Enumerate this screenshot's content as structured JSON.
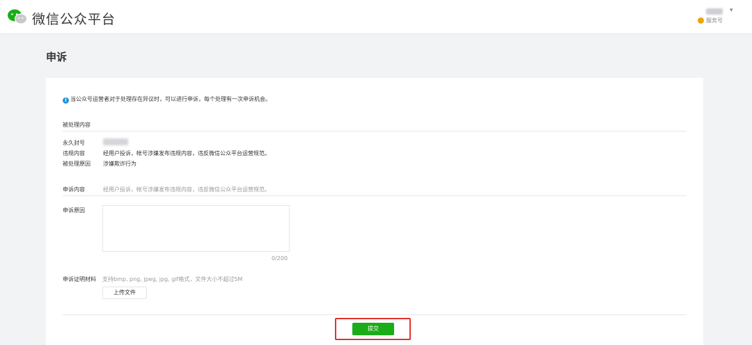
{
  "header": {
    "logo_text": "微信公众平台",
    "account_type": "服务号",
    "caret": "▾"
  },
  "page": {
    "title": "申诉"
  },
  "notice": {
    "icon": "info-icon",
    "icon_glyph": "i",
    "text": "当公众号运营者对于处理存在异议时，可以进行申诉，每个处理有一次申诉机会。"
  },
  "handled_section": {
    "title": "被处理内容",
    "rows": [
      {
        "label": "永久封号",
        "value": ""
      },
      {
        "label": "违规内容",
        "value": "经用户投诉，帐号涉嫌发布违规内容，违反微信公众平台运营规范。"
      },
      {
        "label": "被处理原因",
        "value": "涉嫌欺诈行为"
      }
    ]
  },
  "appeal": {
    "content_label": "申诉内容",
    "content_value": "经用户投诉，帐号涉嫌发布违规内容，违反微信公众平台运营规范。",
    "reason_label": "申诉原因",
    "reason_value": "",
    "counter": "0/200",
    "evidence_label": "申诉证明材料",
    "evidence_hint": "支持bmp, png, jpeg, jpg, gif格式，文件大小不超过5M",
    "upload_label": "上传文件"
  },
  "actions": {
    "submit_label": "提交"
  },
  "colors": {
    "accent_green": "#1aad19",
    "highlight_red": "#e1322e",
    "info_blue": "#1e96d8",
    "badge_orange": "#f0a30a"
  }
}
